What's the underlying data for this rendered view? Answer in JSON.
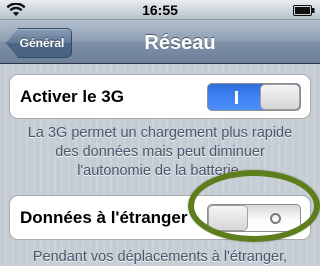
{
  "status_bar": {
    "time": "16:55",
    "icons": [
      "wifi-icon",
      "battery-icon"
    ]
  },
  "nav_bar": {
    "back_label": "Général",
    "title": "Réseau"
  },
  "settings": {
    "enable_3g": {
      "label": "Activer le 3G",
      "value": true,
      "on_text": "I",
      "footer": "La 3G permet un chargement plus rapide des données mais peut diminuer l'autonomie de la batterie."
    },
    "data_roaming": {
      "label": "Données à l'étranger",
      "value": false,
      "off_text": "O",
      "footer": "Pendant vos déplacements à l'étranger,"
    }
  },
  "colors": {
    "toggle_on": "#3f82f3",
    "nav_bar": "#7d90a6",
    "annotation_ring": "#5e7e1d",
    "footer_text": "#4c566c"
  }
}
